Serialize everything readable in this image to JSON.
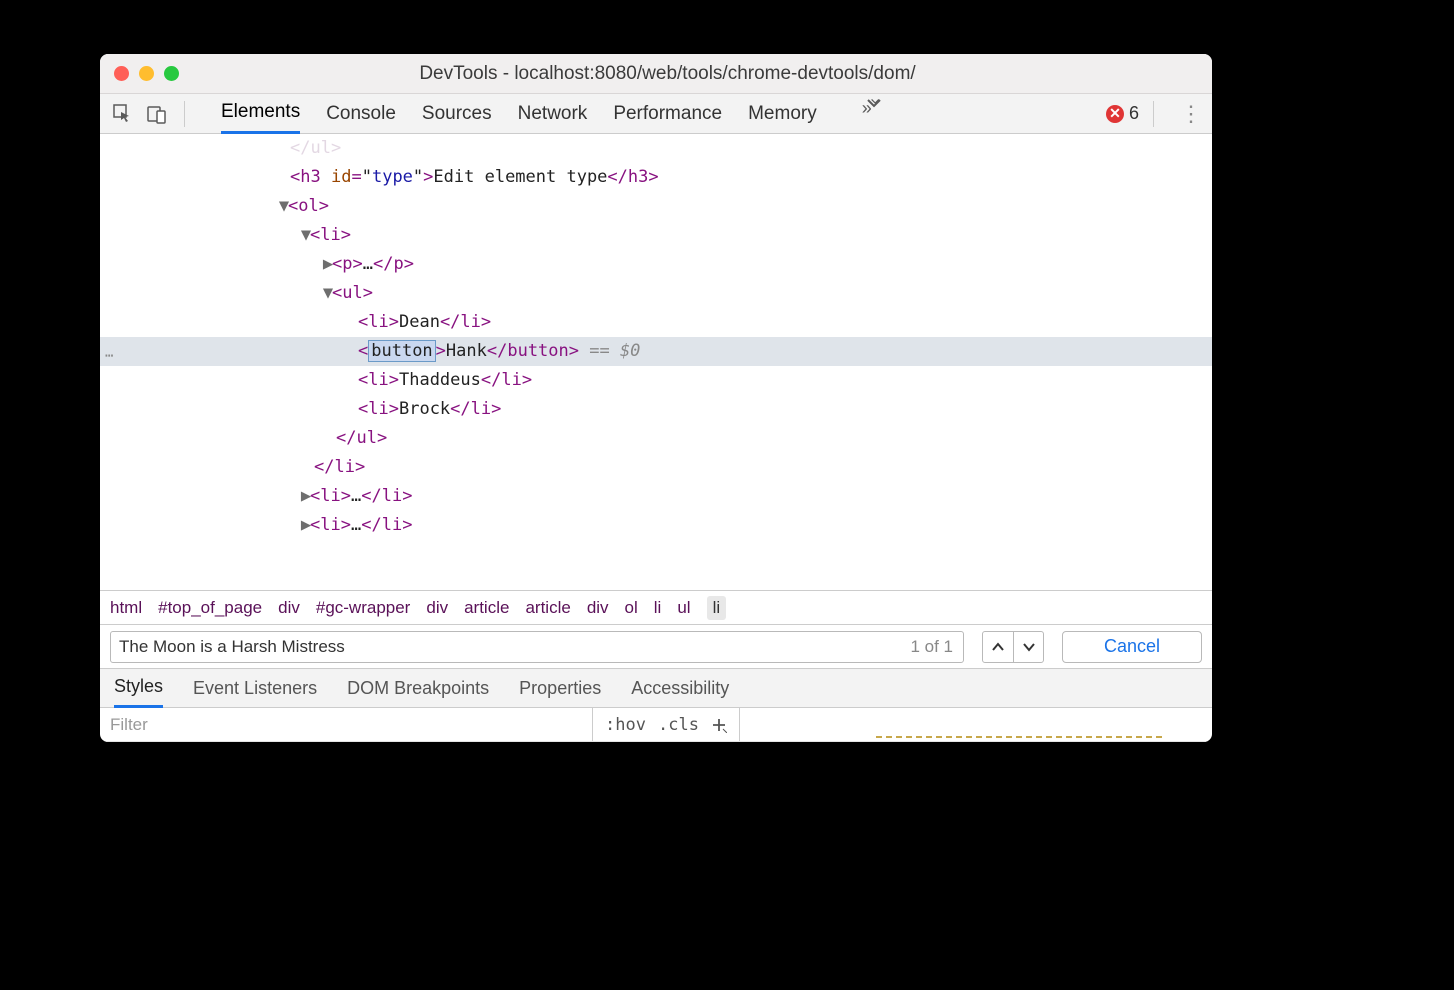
{
  "window": {
    "title": "DevTools - localhost:8080/web/tools/chrome-devtools/dom/"
  },
  "toolbar": {
    "panels": [
      "Elements",
      "Console",
      "Sources",
      "Network",
      "Performance",
      "Memory"
    ],
    "active_panel": "Elements",
    "error_count": "6"
  },
  "dom": {
    "lines": [
      {
        "indent": 190,
        "arrow": "",
        "html_faded": "</ul>"
      },
      {
        "indent": 190,
        "arrow": "",
        "html": "<h3 id=\"type\">Edit element type</h3>"
      },
      {
        "indent": 178,
        "arrow": "▼",
        "html": "<ol>"
      },
      {
        "indent": 200,
        "arrow": "▼",
        "html": "<li>"
      },
      {
        "indent": 222,
        "arrow": "▶",
        "html": "<p>…</p>"
      },
      {
        "indent": 222,
        "arrow": "▼",
        "html": "<ul>"
      },
      {
        "indent": 258,
        "arrow": "",
        "html": "<li>Dean</li>"
      },
      {
        "indent": 258,
        "arrow": "",
        "selected": true,
        "edit_tag": "button",
        "text": "Hank",
        "close_tag": "</button>",
        "suffix": " == $0"
      },
      {
        "indent": 258,
        "arrow": "",
        "html": "<li>Thaddeus</li>"
      },
      {
        "indent": 258,
        "arrow": "",
        "html": "<li>Brock</li>"
      },
      {
        "indent": 236,
        "arrow": "",
        "html": "</ul>"
      },
      {
        "indent": 214,
        "arrow": "",
        "html": "</li>"
      },
      {
        "indent": 200,
        "arrow": "▶",
        "html": "<li>…</li>"
      },
      {
        "indent": 200,
        "arrow": "▶",
        "html": "<li>…</li>"
      }
    ],
    "gutter_ellipsis": "⋯"
  },
  "breadcrumbs": [
    "html",
    "#top_of_page",
    "div",
    "#gc-wrapper",
    "div",
    "article",
    "article",
    "div",
    "ol",
    "li",
    "ul",
    "li"
  ],
  "breadcrumb_active_index": 11,
  "search": {
    "value": "The Moon is a Harsh Mistress",
    "count": "1 of 1",
    "cancel_label": "Cancel"
  },
  "subpanels": [
    "Styles",
    "Event Listeners",
    "DOM Breakpoints",
    "Properties",
    "Accessibility"
  ],
  "subpanel_active": "Styles",
  "filter": {
    "placeholder": "Filter",
    "hov": ":hov",
    "cls": ".cls"
  }
}
